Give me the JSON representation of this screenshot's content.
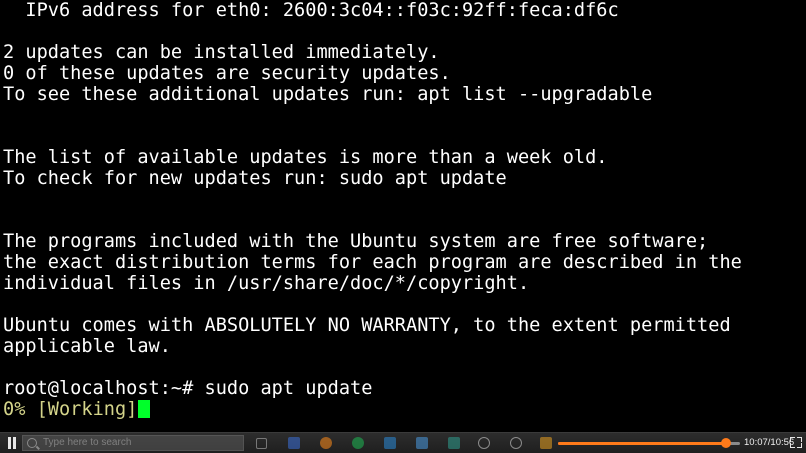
{
  "terminal": {
    "lines": {
      "l0": "  IPv6 address for eth0: 2600:3c04::f03c:92ff:feca:df6c",
      "l2": "2 updates can be installed immediately.",
      "l3": "0 of these updates are security updates.",
      "l4": "To see these additional updates run: apt list --upgradable",
      "l7": "The list of available updates is more than a week old.",
      "l8": "To check for new updates run: sudo apt update",
      "l11": "The programs included with the Ubuntu system are free software;",
      "l12": "the exact distribution terms for each program are described in the",
      "l13": "individual files in /usr/share/doc/*/copyright.",
      "l15": "Ubuntu comes with ABSOLUTELY NO WARRANTY, to the extent permitted",
      "l16": "applicable law.",
      "l18": "root@localhost:~# sudo apt update",
      "l19_progress": "0% ",
      "l19_status": "[Working]"
    }
  },
  "player": {
    "search_placeholder": "Type here to search",
    "time": "10:07/10:56",
    "progress_fraction": 0.921,
    "colors": {
      "seek_fill": "#ff7a1a",
      "cursor": "#00ff2a"
    },
    "taskbar_icons": [
      "task-view-icon",
      "browser-icon",
      "spotify-icon",
      "store-icon",
      "mail-icon",
      "charts-icon",
      "app-icon",
      "settings-icon",
      "folder-icon"
    ]
  }
}
